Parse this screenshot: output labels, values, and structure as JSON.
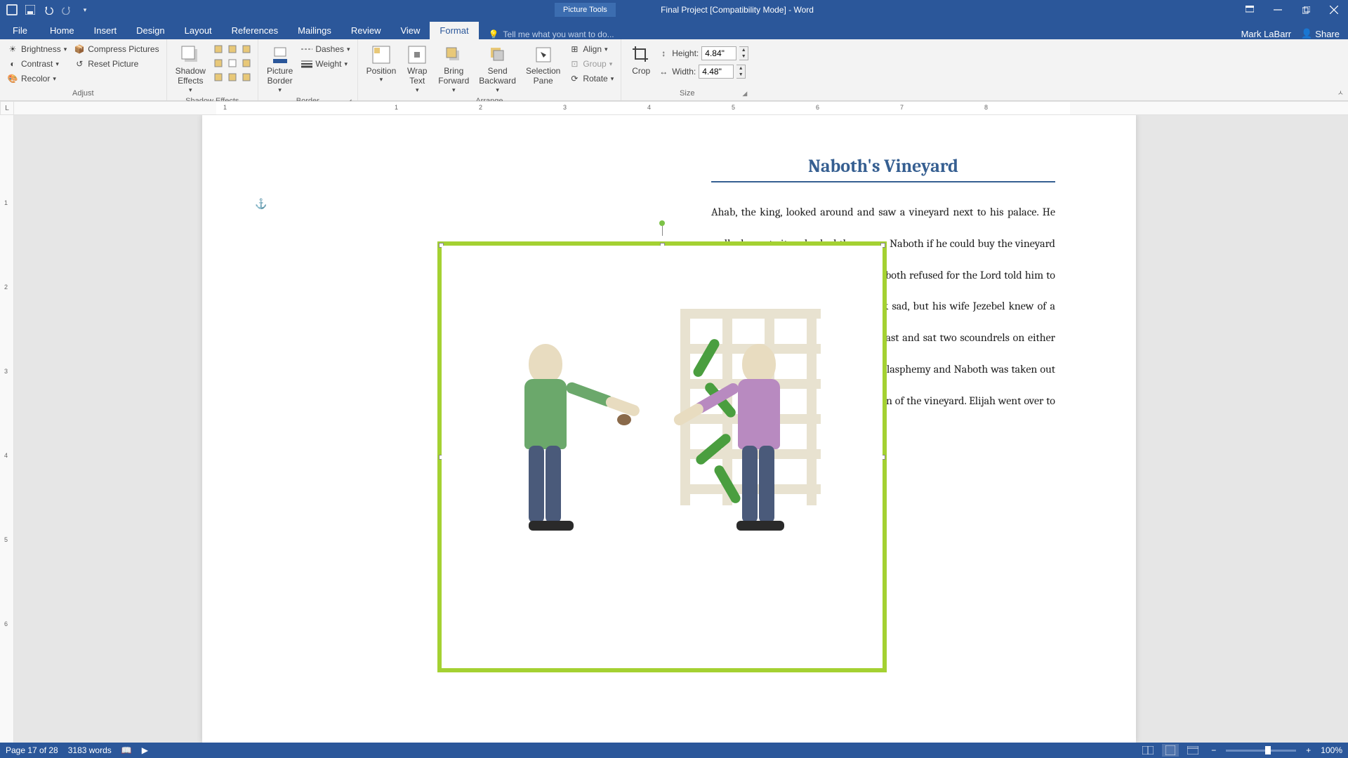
{
  "titlebar": {
    "tools_label": "Picture Tools",
    "title": "Final Project [Compatibility Mode] - Word"
  },
  "tabs": {
    "file": "File",
    "home": "Home",
    "insert": "Insert",
    "design": "Design",
    "layout": "Layout",
    "references": "References",
    "mailings": "Mailings",
    "review": "Review",
    "view": "View",
    "format": "Format",
    "tellme_placeholder": "Tell me what you want to do...",
    "user": "Mark LaBarr",
    "share": "Share"
  },
  "ribbon": {
    "adjust": {
      "brightness": "Brightness",
      "contrast": "Contrast",
      "recolor": "Recolor",
      "compress": "Compress Pictures",
      "reset": "Reset Picture",
      "label": "Adjust"
    },
    "shadow": {
      "button": "Shadow\nEffects",
      "label": "Shadow Effects"
    },
    "border": {
      "button": "Picture\nBorder",
      "dashes": "Dashes",
      "weight": "Weight",
      "label": "Border"
    },
    "arrange": {
      "position": "Position",
      "wrap": "Wrap\nText",
      "bring": "Bring\nForward",
      "send": "Send\nBackward",
      "selection": "Selection\nPane",
      "align": "Align",
      "group": "Group",
      "rotate": "Rotate",
      "label": "Arrange"
    },
    "crop": {
      "button": "Crop"
    },
    "size": {
      "height_label": "Height:",
      "height_value": "4.84\"",
      "width_label": "Width:",
      "width_value": "4.48\"",
      "label": "Size"
    }
  },
  "ruler": {
    "corner": "L",
    "h_marks": [
      "1",
      "1",
      "2",
      "3",
      "4",
      "5",
      "6",
      "7",
      "8"
    ],
    "v_marks": [
      "1",
      "2",
      "3",
      "4",
      "5",
      "6"
    ]
  },
  "document": {
    "title": "Naboth's Vineyard",
    "body": "Ahab, the king, looked around and saw a vineyard next to his palace. He walked over to it and asked the owner, Naboth if he could buy the vineyard or give Naboth an even better one. Naboth refused for the Lord told him to keep his inheritance. Ahab went back sad, but his wife Jezebel knew of a way to get the vineyard. She held a feast and sat two scoundrels on either side of Naboth. They accused him of blasphemy and Naboth was taken out and stoned. Later, Ahab took possession of the vineyard. Elijah went over to Ahab to tell him"
  },
  "statusbar": {
    "page": "Page 17 of 28",
    "words": "3183 words",
    "zoom": "100%"
  }
}
